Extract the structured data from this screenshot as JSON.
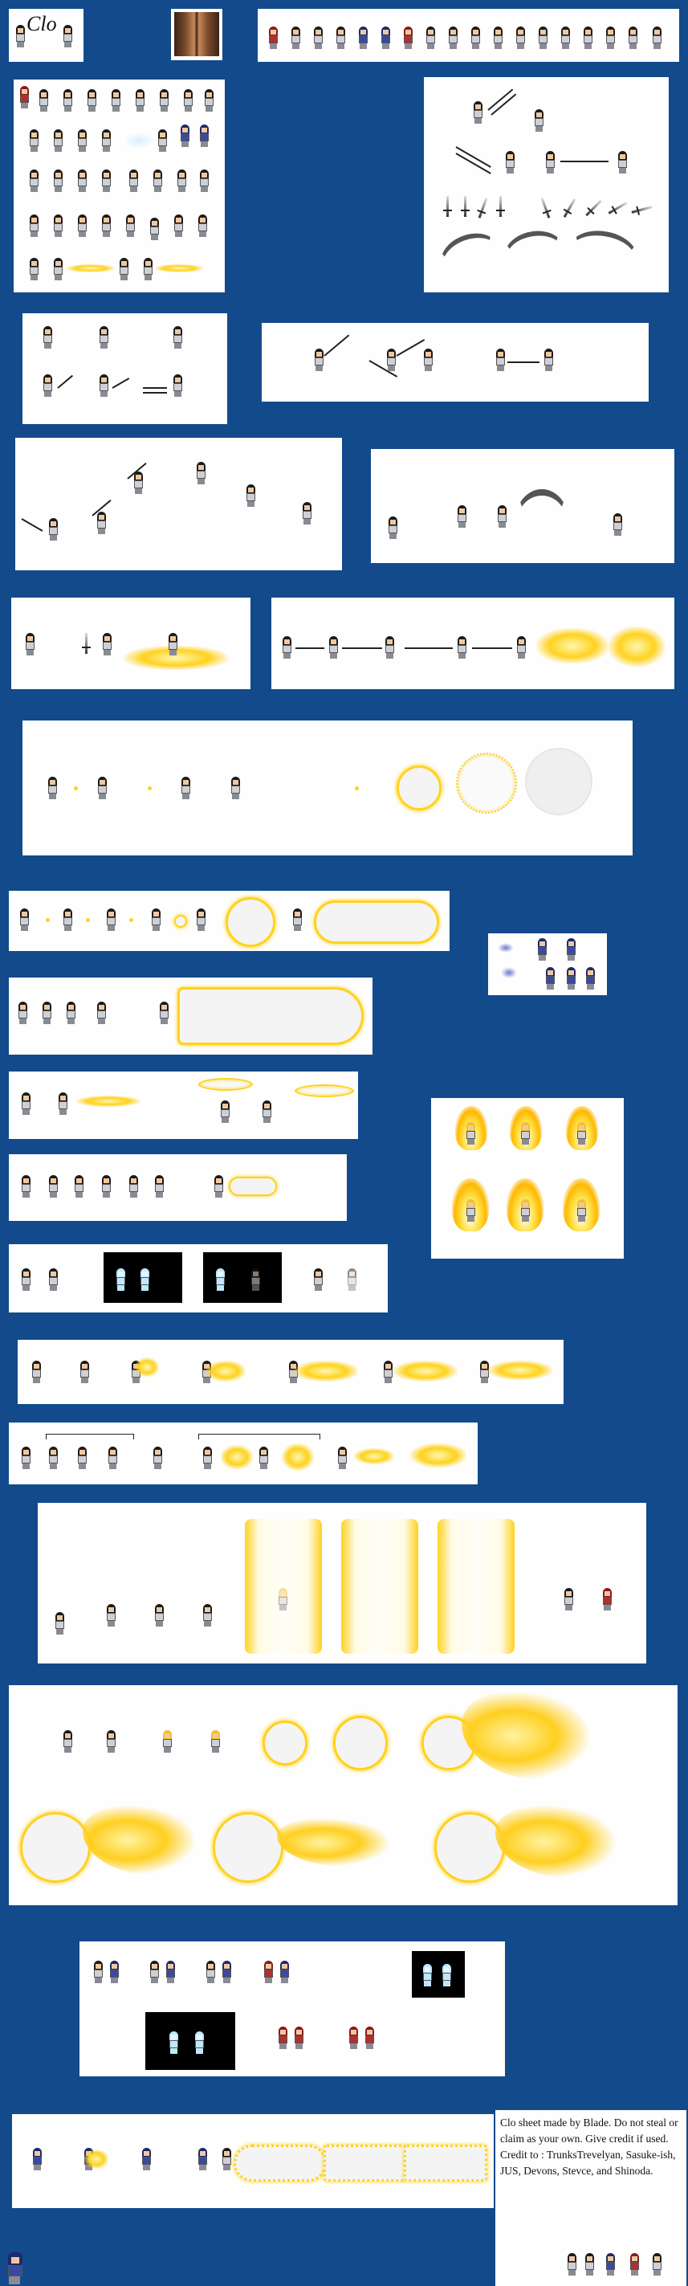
{
  "sheet": {
    "character_name": "Clo",
    "background_color": "#124a8c",
    "accent_color": "#ffd21f"
  },
  "credits": {
    "line1": "Clo sheet made by Blade. Do not steal or claim as your own. Give credit if used.",
    "line2": "Credit to : TrunksTrevelyan, Sasuke-ish, JUS, Devons, Stevce, and Shinoda."
  },
  "icons": [
    "character-sprite",
    "sword-icon",
    "energy-orb",
    "energy-beam",
    "phoenix-effect",
    "golden-aura"
  ]
}
